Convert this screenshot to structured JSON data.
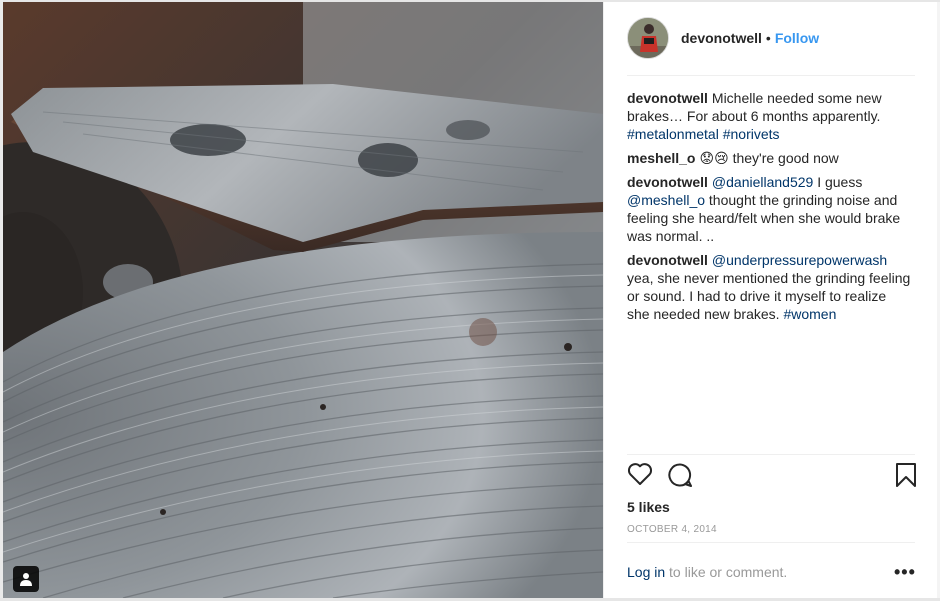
{
  "post": {
    "username": "devonotwell",
    "follow_label": "Follow",
    "separator": "•",
    "likes": "5 likes",
    "date": "OCTOBER 4, 2014",
    "login_link": "Log in",
    "login_suffix": " to like or comment.",
    "more_label": "•••"
  },
  "comments": [
    {
      "user": "devonotwell",
      "parts": [
        {
          "type": "text",
          "value": "Michelle needed some new brakes… For about 6 months apparently. "
        },
        {
          "type": "link",
          "value": "#metalonmetal"
        },
        {
          "type": "text",
          "value": " "
        },
        {
          "type": "link",
          "value": "#norivets"
        }
      ]
    },
    {
      "user": "meshell_o",
      "parts": [
        {
          "type": "text",
          "value": "😟😢 they're good now"
        }
      ]
    },
    {
      "user": "devonotwell",
      "parts": [
        {
          "type": "link",
          "value": "@danielland529"
        },
        {
          "type": "text",
          "value": " I guess "
        },
        {
          "type": "link",
          "value": "@meshell_o"
        },
        {
          "type": "text",
          "value": " thought the grinding noise and feeling she heard/felt when she would brake was normal. .."
        }
      ]
    },
    {
      "user": "devonotwell",
      "parts": [
        {
          "type": "link",
          "value": "@underpressurepowerwash"
        },
        {
          "type": "text",
          "value": " yea, she never mentioned the grinding feeling or sound. I had to drive it myself to realize she needed new brakes. "
        },
        {
          "type": "link",
          "value": "#women"
        }
      ]
    }
  ],
  "icons": {
    "like": "heart-outline-icon",
    "comment": "speech-bubble-icon",
    "save": "bookmark-icon",
    "user_tags": "person-icon"
  },
  "colors": {
    "link": "#003569",
    "follow": "#3897f0",
    "muted": "#999999",
    "text": "#262626"
  }
}
